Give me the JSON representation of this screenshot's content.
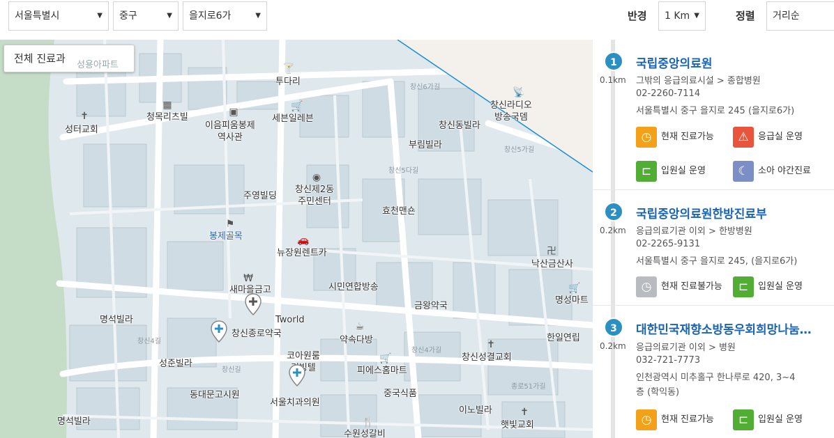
{
  "filters": {
    "city": "서울특별시",
    "district": "중구",
    "dong": "을지로6가",
    "radius_label": "반경",
    "radius": "1 Km",
    "sort_label": "정렬",
    "sort": "거리순"
  },
  "map": {
    "department_button": "전체 진료과",
    "labels": {
      "tudari": "투다리",
      "changsin_radio": "창신라디오\n방송국뎀",
      "seongteo_church": "성터교회",
      "cheongmok": "청목리츠빌",
      "ieum": "이음피움봉제\n역사관",
      "seven_eleven": "세븐일레븐",
      "changsin_villa": "창신동빌라",
      "burim": "부림빌라",
      "juyoung": "주영빌딩",
      "changsin2": "창신제2동\n주민센터",
      "hyocheon": "효천맨숀",
      "bongje": "봉제골목",
      "newjang": "뉴장원렌트카",
      "naksan_temple": "낙산금산사",
      "saemaeul": "새마을금고",
      "simin": "시민연합방송",
      "myeongseong_mart": "명성마트",
      "myeongseok_villa": "명석빌라",
      "geumwang": "금왕약국",
      "tworld": "Tworld",
      "changsin_pharmacy": "창신종로약국",
      "yaksok": "약속다방",
      "hanil": "한일연립",
      "seongjun": "성준빌라",
      "koa": "코아원룸\n리빙텔",
      "pies": "피에스홈마트",
      "changsin_church": "창신성결교회",
      "dongdaemun": "동대문고시원",
      "seoul_dental": "서울치과의원",
      "jungguk": "중국식품",
      "ino": "이노빌라",
      "myeongseok_villa2": "명석빌라",
      "hatbit": "햇빛교회",
      "suwon": "수원성갈비",
      "seongyang": "성용아파트"
    },
    "roads": {
      "r1": "창신6가길",
      "r2": "창신5다길",
      "r3": "창신4길",
      "r4": "창신길",
      "r5": "종로51가길",
      "r6": "창신5가길",
      "r7": "창신4가길"
    }
  },
  "results": [
    {
      "number": "1",
      "distance": "0.1km",
      "name": "국립중앙의료원",
      "category": "그밖의 응급의료시설 > 종합병원",
      "phone": "02-2260-7114",
      "address": "서울특별시 중구 을지로 245 (을지로6가)",
      "tags": [
        "현재 진료가능",
        "응급실 운영",
        "입원실 운영",
        "소아 야간진료"
      ]
    },
    {
      "number": "2",
      "distance": "0.2km",
      "name": "국립중앙의료원한방진료부",
      "category": "응급의료기관 이외 > 한방병원",
      "phone": "02-2265-9131",
      "address": "서울특별시 중구 을지로 245, (을지로6가)",
      "tags": [
        "현재 진료불가능",
        "입원실 운영"
      ]
    },
    {
      "number": "3",
      "distance": "0.2km",
      "name": "대한민국재향소방동우회희망나눔…",
      "category": "응급의료기관 이외 > 병원",
      "phone": "032-721-7773",
      "address": "인천광역시 미추홀구 한나루로 420, 3~4",
      "address2": "층 (학익동)",
      "tags": [
        "현재 진료가능",
        "입원실 운영"
      ]
    }
  ],
  "colors": {
    "accent": "#1a64b4",
    "badge": "#2b8fc1",
    "available": "#f4a11a",
    "emergency": "#e8543c",
    "inpatient": "#52ad35",
    "night": "#7b8fc6",
    "unavailable": "#b8bcc0"
  },
  "icons": {
    "clock": "clock-icon",
    "siren": "siren-icon",
    "bed": "bed-icon",
    "moon": "moon-icon"
  }
}
